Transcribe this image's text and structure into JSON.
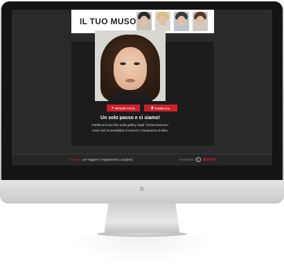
{
  "banner": {
    "title": "IL TUO MUSO",
    "thumbnails": [
      {
        "hair": "#2a2a2a",
        "bg": "#c9c2b8"
      },
      {
        "hair": "#d9c07a",
        "bg": "#d8d4cc"
      },
      {
        "hair": "#3a3a3a",
        "bg": "#bfc4c9"
      },
      {
        "hair": "#5a3a26",
        "bg": "#cfc9c0"
      }
    ]
  },
  "actions": {
    "retake_label": "RIFARE FOTO",
    "retake_icon": "camera-icon",
    "publish_label": "PUBBLICA",
    "publish_icon": "video-icon"
  },
  "message": {
    "title": "Un solo passo e ci siamo!",
    "line1": "Pubblica la tua foto sulla gallery degli \"Schiacciamuso\"",
    "line2": "Avrai così la possibilità di vincere 2 fantastiche E-Bike."
  },
  "footer": {
    "link": "Clicca qui",
    "text": " per leggere il regolamento completo.",
    "powered": "POWERED BY",
    "brand": "BOSCH"
  },
  "device": {
    "logo": "b"
  },
  "colors": {
    "accent": "#d0202b",
    "screen_bg": "#2a2a2a"
  }
}
